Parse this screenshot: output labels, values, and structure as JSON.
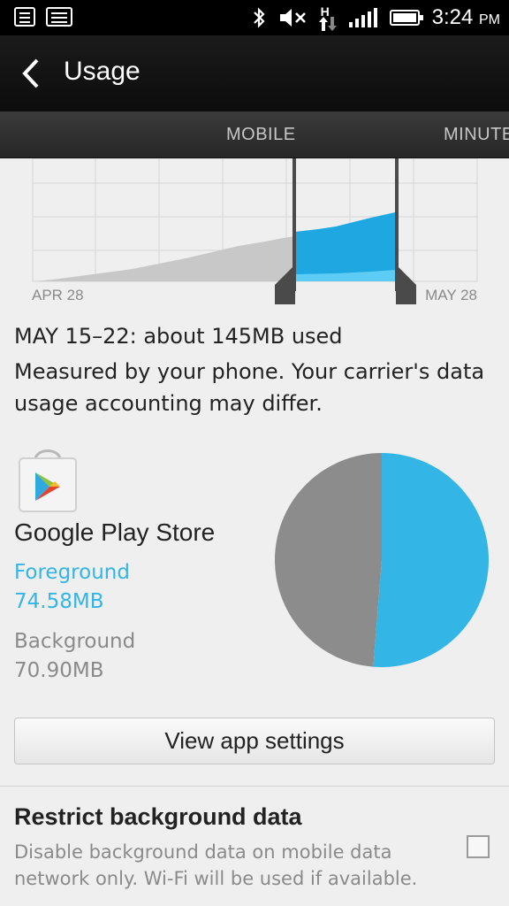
{
  "status_bar": {
    "time": "3:24",
    "ampm": "PM",
    "data_indicator": "H",
    "icons": [
      "notes-icon",
      "image-icon",
      "bluetooth-icon",
      "mute-icon",
      "hspa-data-icon",
      "signal-icon",
      "battery-icon"
    ]
  },
  "action_bar": {
    "title": "Usage",
    "back_icon": "chevron-left-icon"
  },
  "tabs": [
    {
      "label": "MOBILE",
      "selected": true
    },
    {
      "label": "MINUTES",
      "selected": false
    }
  ],
  "chart": {
    "start_label": "APR 28",
    "end_label": "MAY 28",
    "selected_range": "MAY 15–22",
    "colors": {
      "total": "#c8c8c8",
      "selected_background": "#1ea7e1",
      "selected_foreground": "#5ecdf5",
      "handle": "#4a4a4a",
      "grid": "#d6d6d6"
    }
  },
  "summary": {
    "title": "MAY 15–22: about 145MB used",
    "note": "Measured by your phone. Your carrier's data usage accounting may differ."
  },
  "app": {
    "name": "Google Play Store",
    "icon": "play-store-icon",
    "foreground_label": "Foreground",
    "foreground_value": "74.58MB",
    "background_label": "Background",
    "background_value": "70.90MB",
    "pie": {
      "foreground_mb": 74.58,
      "background_mb": 70.9,
      "foreground_color": "#33b5e5",
      "background_color": "#8c8c8c"
    }
  },
  "settings_button": {
    "label": "View app settings"
  },
  "restrict": {
    "title": "Restrict background data",
    "description": "Disable background data on mobile data network only. Wi-Fi will be used if available.",
    "checked": false
  }
}
